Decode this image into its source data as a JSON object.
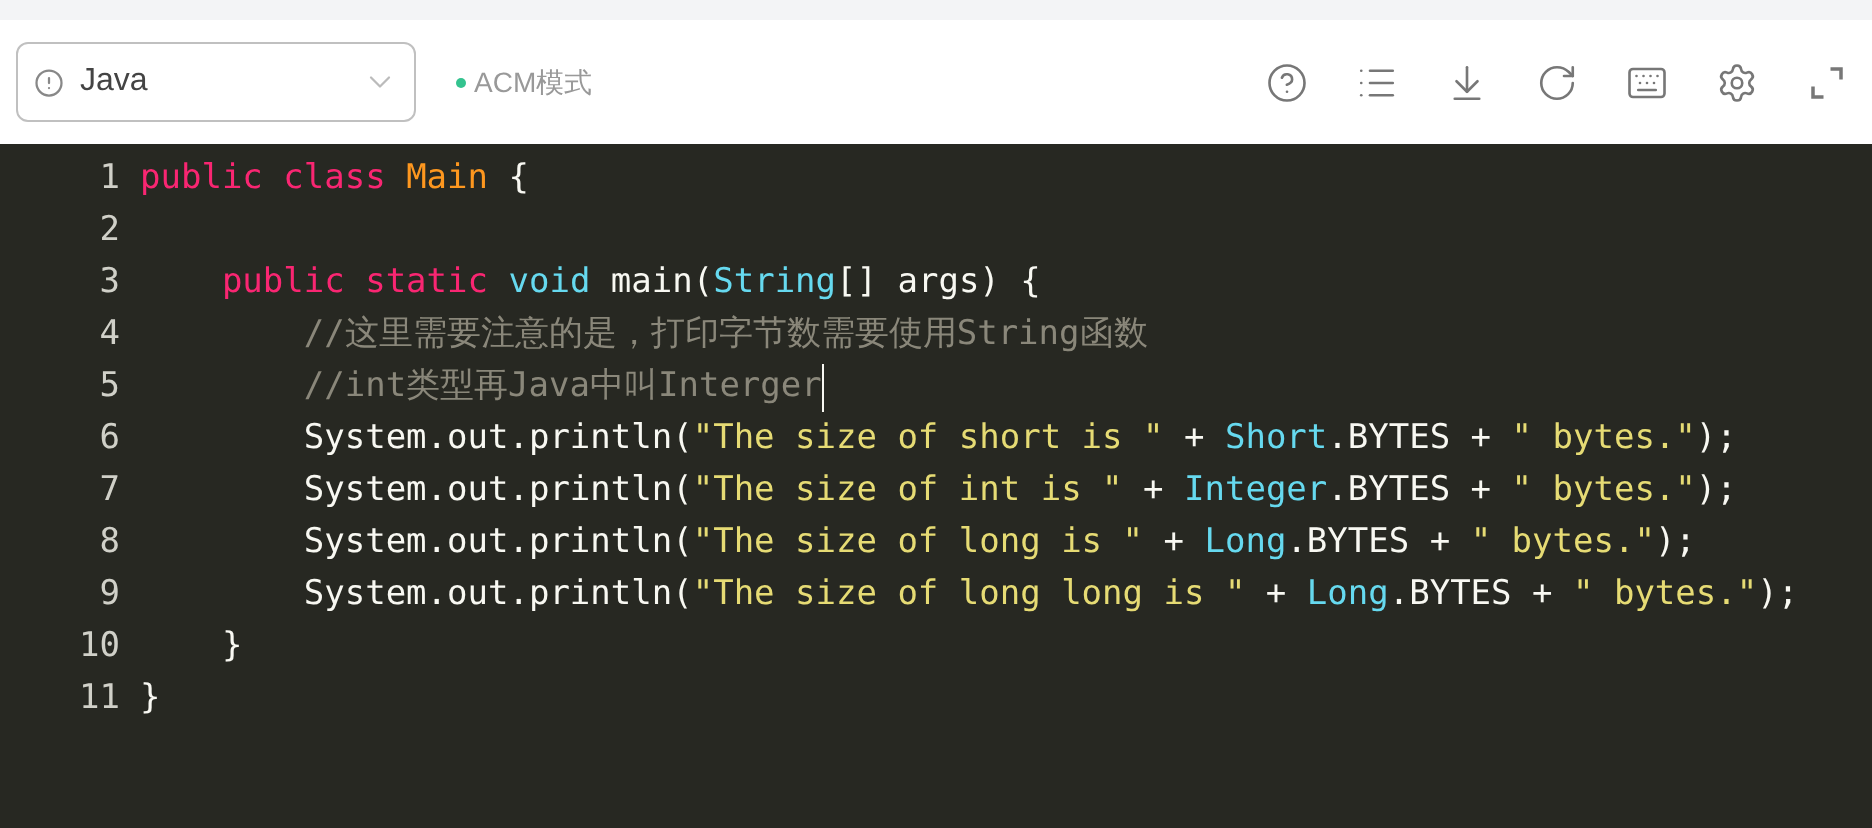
{
  "toolbar": {
    "language_select": {
      "value": "Java"
    },
    "mode": {
      "label": "ACM模式",
      "color": "#34c38f"
    }
  },
  "editor": {
    "lines": [
      {
        "number": "1",
        "cursor": false,
        "tokens": [
          {
            "kind": "keyword",
            "text": "public class "
          },
          {
            "kind": "class",
            "text": "Main"
          },
          {
            "kind": "plain",
            "text": " {"
          }
        ]
      },
      {
        "number": "2",
        "cursor": false
      },
      {
        "number": "3",
        "cursor": false,
        "tokens": [
          {
            "kind": "keyword",
            "text": "    public static "
          },
          {
            "kind": "type",
            "text": "void"
          },
          {
            "kind": "plain",
            "text": " main("
          },
          {
            "kind": "type",
            "text": "String"
          },
          {
            "kind": "plain",
            "text": "[] args) {"
          }
        ]
      },
      {
        "number": "4",
        "cursor": false,
        "tokens": [
          {
            "kind": "comment",
            "text": "        //这里需要注意的是，打印字节数需要使用String函数"
          }
        ]
      },
      {
        "number": "5",
        "cursor": true,
        "tokens": [
          {
            "kind": "comment",
            "text": "        //int类型再Java中叫Interger"
          }
        ]
      },
      {
        "number": "6",
        "cursor": false,
        "tokens": [
          {
            "kind": "plain",
            "text": "        System.out.println("
          },
          {
            "kind": "string",
            "text": "\"The size of short is \""
          },
          {
            "kind": "plain",
            "text": " + "
          },
          {
            "kind": "type",
            "text": "Short"
          },
          {
            "kind": "plain",
            "text": ".BYTES + "
          },
          {
            "kind": "string",
            "text": "\" bytes.\""
          },
          {
            "kind": "plain",
            "text": ");"
          }
        ]
      },
      {
        "number": "7",
        "cursor": false,
        "tokens": [
          {
            "kind": "plain",
            "text": "        System.out.println("
          },
          {
            "kind": "string",
            "text": "\"The size of int is \""
          },
          {
            "kind": "plain",
            "text": " + "
          },
          {
            "kind": "type",
            "text": "Integer"
          },
          {
            "kind": "plain",
            "text": ".BYTES + "
          },
          {
            "kind": "string",
            "text": "\" bytes.\""
          },
          {
            "kind": "plain",
            "text": ");"
          }
        ]
      },
      {
        "number": "8",
        "cursor": false,
        "tokens": [
          {
            "kind": "plain",
            "text": "        System.out.println("
          },
          {
            "kind": "string",
            "text": "\"The size of long is \""
          },
          {
            "kind": "plain",
            "text": " + "
          },
          {
            "kind": "type",
            "text": "Long"
          },
          {
            "kind": "plain",
            "text": ".BYTES + "
          },
          {
            "kind": "string",
            "text": "\" bytes.\""
          },
          {
            "kind": "plain",
            "text": ");"
          }
        ]
      },
      {
        "number": "9",
        "cursor": false,
        "tokens": [
          {
            "kind": "plain",
            "text": "        System.out.println("
          },
          {
            "kind": "string",
            "text": "\"The size of long long is \""
          },
          {
            "kind": "plain",
            "text": " + "
          },
          {
            "kind": "type",
            "text": "Long"
          },
          {
            "kind": "plain",
            "text": ".BYTES + "
          },
          {
            "kind": "string",
            "text": "\" bytes.\""
          },
          {
            "kind": "plain",
            "text": ");"
          }
        ]
      },
      {
        "number": "10",
        "cursor": false,
        "tokens": [
          {
            "kind": "plain",
            "text": "    }"
          }
        ]
      },
      {
        "number": "11",
        "cursor": false,
        "tokens": [
          {
            "kind": "plain",
            "text": "}"
          }
        ]
      }
    ]
  }
}
